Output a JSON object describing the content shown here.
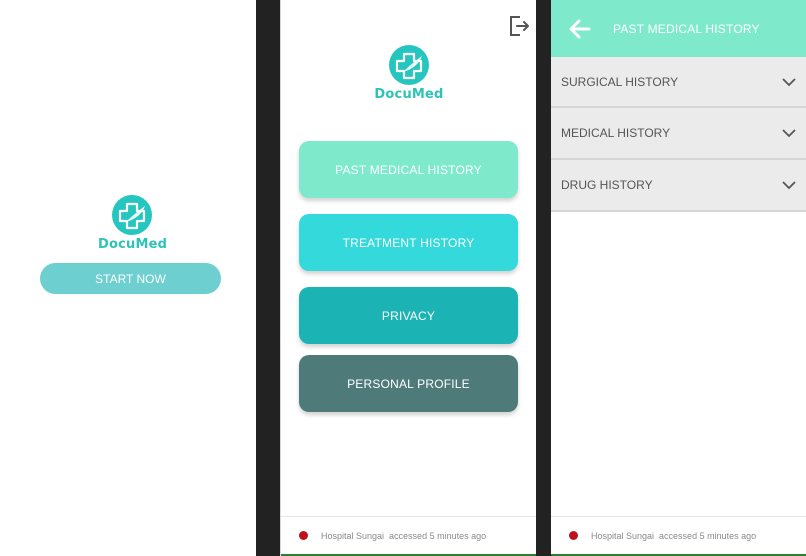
{
  "colors": {
    "logo_teal": "#26c6c0",
    "start_button": "#6dcfcf",
    "past_medical_history": "#7eeacb",
    "treatment_history": "#34d9db",
    "privacy": "#1cb3b5",
    "personal_profile": "#4e7b7a",
    "header": "#7eeacb",
    "access_dot": "#c0121b"
  },
  "splash": {
    "logo_text": "DocuMed",
    "start_label": "START NOW"
  },
  "home": {
    "logo_text": "DocuMed",
    "logout_icon": "logout-icon",
    "menu": [
      {
        "label": "PAST MEDICAL HISTORY"
      },
      {
        "label": "TREATMENT HISTORY"
      },
      {
        "label": "PRIVACY"
      },
      {
        "label": "PERSONAL PROFILE"
      }
    ],
    "access": {
      "hospital": "Hospital Sungai",
      "text": "accessed 5 minutes ago"
    }
  },
  "history": {
    "back_icon": "arrow-left-icon",
    "title": "PAST MEDICAL HISTORY",
    "sections": [
      {
        "label": "SURGICAL HISTORY"
      },
      {
        "label": "MEDICAL HISTORY"
      },
      {
        "label": "DRUG HISTORY"
      }
    ],
    "access": {
      "hospital": "Hospital Sungai",
      "text": "accessed 5 minutes ago"
    }
  }
}
